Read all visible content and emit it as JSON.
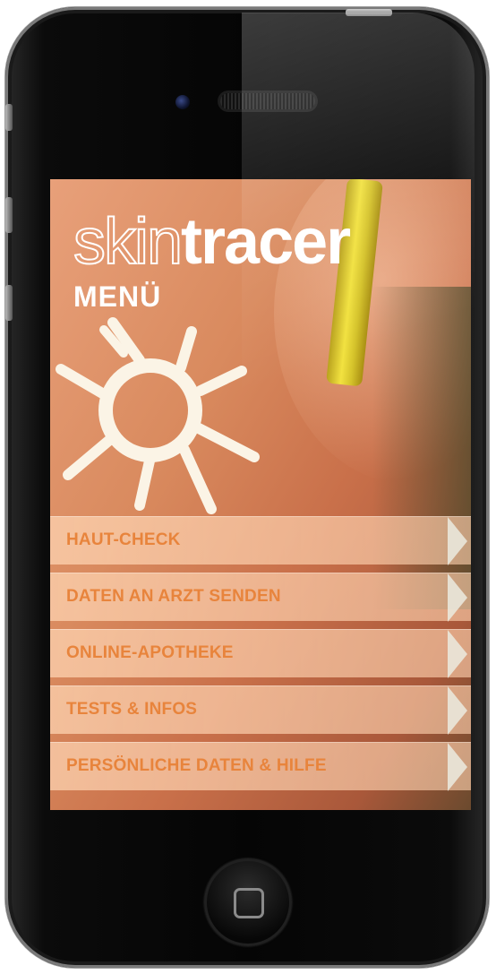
{
  "app": {
    "logo_part1": "skin",
    "logo_part2": "tracer",
    "title": "MENÜ"
  },
  "menu": {
    "items": [
      {
        "label": "HAUT-CHECK"
      },
      {
        "label": "DATEN AN ARZT SENDEN"
      },
      {
        "label": "ONLINE-APOTHEKE"
      },
      {
        "label": "TESTS & INFOS"
      },
      {
        "label": "PERSÖNLICHE DATEN & HILFE"
      }
    ]
  },
  "colors": {
    "menu_text": "#e8843c",
    "menu_bg": "#ffd6b4",
    "header_text": "#ffffff"
  },
  "icons": {
    "menu_arrow": "chevron-right-icon",
    "home_button": "home-square-icon",
    "sun_drawing": "sun-icon"
  }
}
